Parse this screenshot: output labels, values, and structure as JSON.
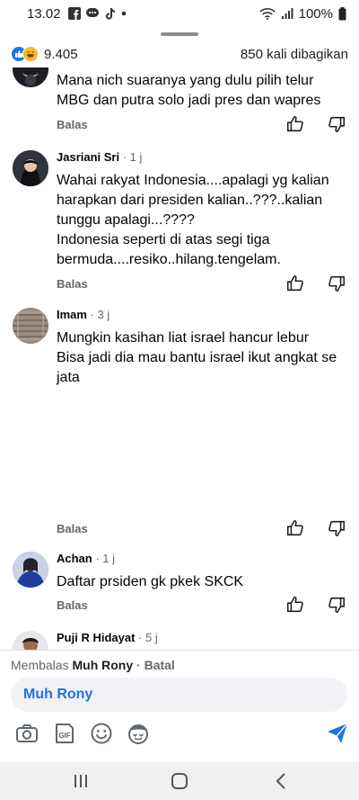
{
  "status": {
    "time": "13.02",
    "battery": "100%",
    "icons": [
      "facebook-icon",
      "chat-bubble-icon",
      "tiktok-icon",
      "dot-icon",
      "wifi-icon",
      "signal-icon",
      "battery-icon"
    ]
  },
  "summary": {
    "reaction_count": "9.405",
    "shares": "850 kali dibagikan",
    "reaction_icons": [
      "like-reaction-icon",
      "haha-reaction-icon"
    ]
  },
  "reply_label": "Balas",
  "comments": [
    {
      "name": "",
      "age": "",
      "text": "Mana nich suaranya yang dulu pilih telur MBG dan putra solo jadi pres dan wapres"
    },
    {
      "name": "Jasriani Sri",
      "age": "· 1 j",
      "text": "Wahai rakyat Indonesia....apalagi yg kalian harapkan dari presiden kalian..???..kalian tunggu apalagi...????\nIndonesia seperti di atas segi tiga bermuda....resiko..hilang.tengelam."
    },
    {
      "name": "Imam",
      "age": "· 3 j",
      "text": "Mungkin kasihan liat israel hancur lebur\nBisa jadi dia mau bantu israel ikut angkat se jata"
    },
    {
      "name": "Achan",
      "age": "· 1 j",
      "text": "Daftar prsiden gk pkek SKCK"
    },
    {
      "name": "Puji R Hidayat",
      "age": "· 5 j",
      "text": ""
    }
  ],
  "composer": {
    "replying_prefix": "Membalas",
    "replying_to": "Muh Rony",
    "cancel": "· Batal",
    "mention": "Muh Rony",
    "tools": [
      "camera-icon",
      "gif-icon",
      "emoji-icon",
      "avatar-sticker-icon",
      "send-icon"
    ]
  },
  "colors": {
    "accent": "#1b74e4",
    "secondary_text": "#65676b"
  }
}
